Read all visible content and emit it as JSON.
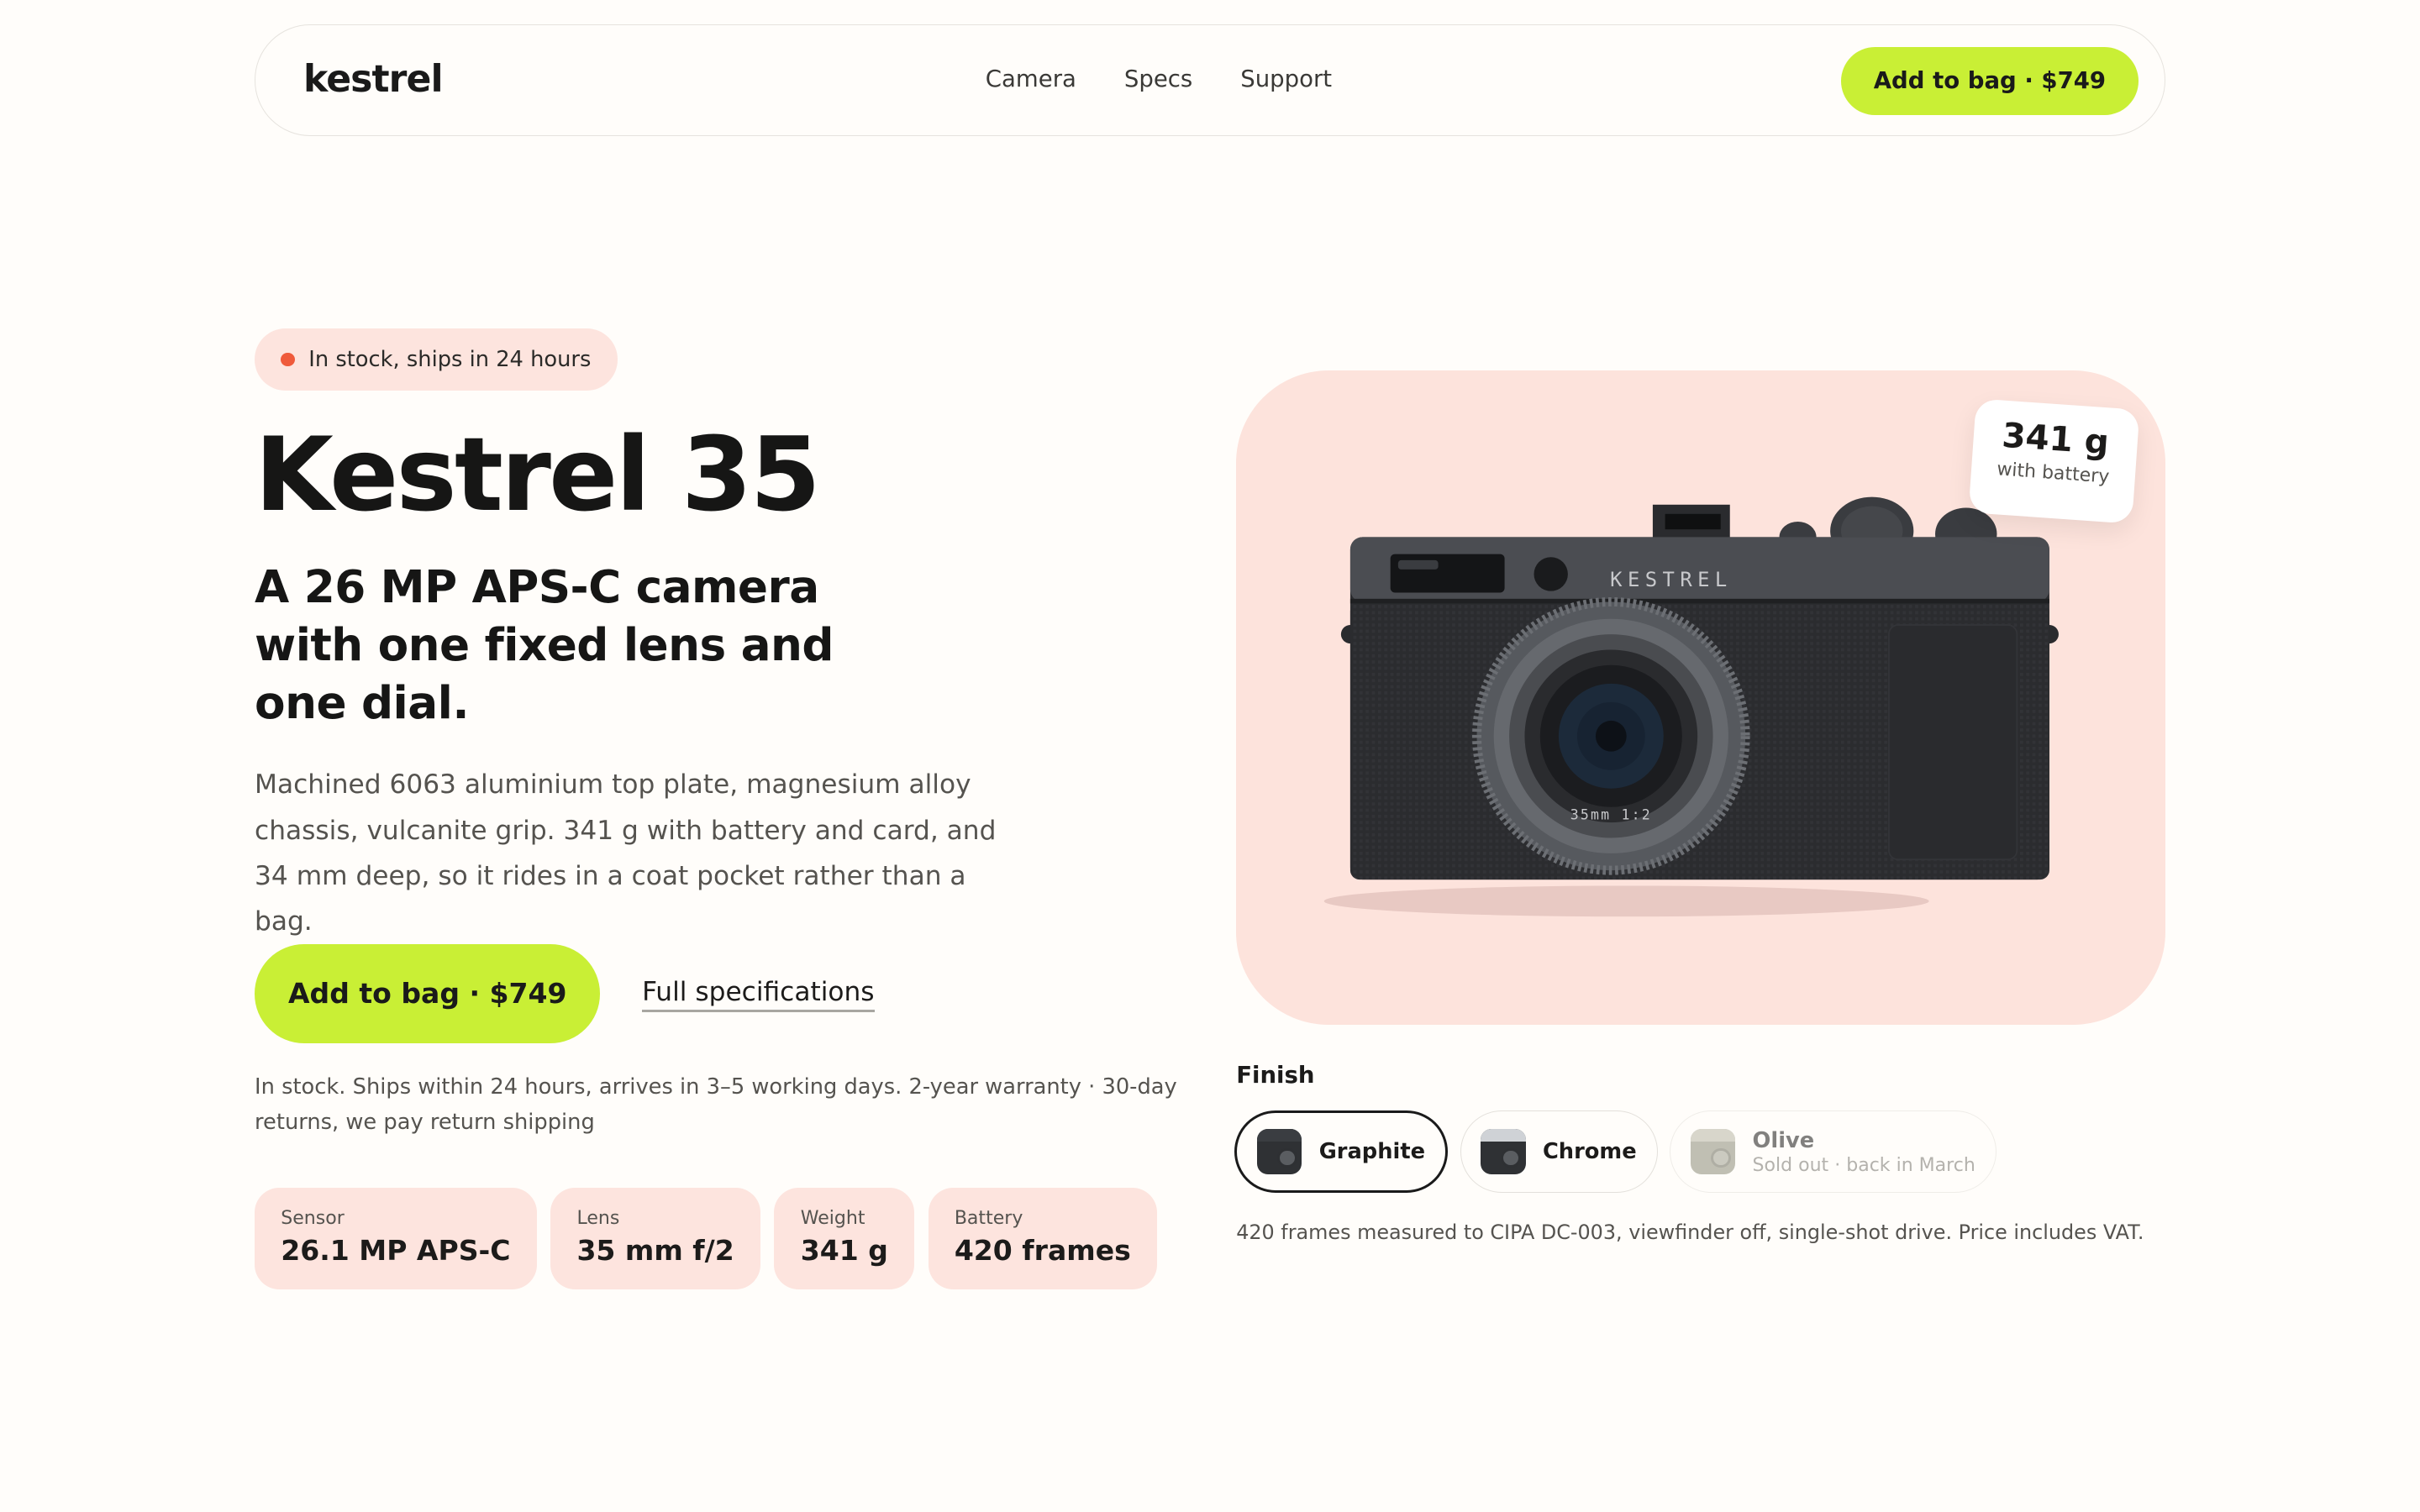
{
  "nav": {
    "logo": "kestrel",
    "links": [
      "Camera",
      "Specs",
      "Support"
    ],
    "cta": "Add to bag · $749"
  },
  "hero": {
    "stock_badge": "In stock, ships in 24 hours",
    "title": "Kestrel 35",
    "subtitle": "A 26 MP APS-C camera with one fixed lens and one dial.",
    "description": "Machined 6063 aluminium top plate, magnesium alloy chassis, vulcanite grip. 341 g with battery and card, and 34 mm deep, so it rides in a coat pocket rather than a bag.",
    "cta": "Add to bag · $749",
    "specs_link": "Full specifications",
    "shipping_note": "In stock. Ships within 24 hours, arrives in 3–5 working days. 2-year warranty · 30-day returns, we pay return shipping"
  },
  "specs": [
    {
      "label": "Sensor",
      "value": "26.1 MP APS-C"
    },
    {
      "label": "Lens",
      "value": "35 mm f/2"
    },
    {
      "label": "Weight",
      "value": "341 g"
    },
    {
      "label": "Battery",
      "value": "420 frames"
    }
  ],
  "product_image": {
    "brand_mark": "KESTREL",
    "lens_marking": "35mm 1:2",
    "weight_tag": {
      "value": "341 g",
      "sub": "with battery"
    }
  },
  "finish": {
    "label": "Finish",
    "options": [
      {
        "name": "Graphite",
        "sub": "",
        "state": "selected",
        "body_color": "#2f3134",
        "band_color": "#3a3d41"
      },
      {
        "name": "Chrome",
        "sub": "",
        "state": "available",
        "body_color": "#2f3134",
        "band_color": "#cfd2d6"
      },
      {
        "name": "Olive",
        "sub": "Sold out · back in March",
        "state": "sold-out",
        "body_color": "#8e8e7a",
        "band_color": "#b9b8a6"
      }
    ],
    "note": "420 frames measured to CIPA DC-003, viewfinder off, single-shot drive. Price includes VAT."
  },
  "colors": {
    "accent": "#c9ef35",
    "pink": "#fde3dc",
    "status_dot": "#ef5a3b",
    "text": "#1c1b1a"
  }
}
